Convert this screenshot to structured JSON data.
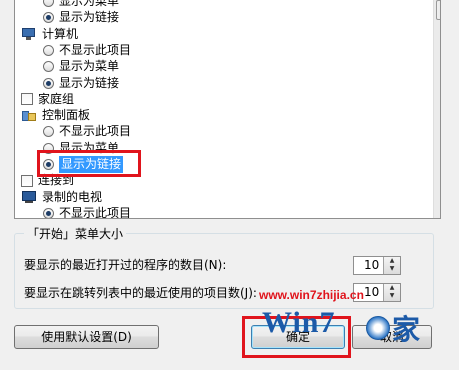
{
  "tree": [
    {
      "type": "radio",
      "checked": false,
      "indent": 1,
      "label": "显示为菜单",
      "icon": null
    },
    {
      "type": "radio",
      "checked": true,
      "indent": 1,
      "label": "显示为链接",
      "icon": null
    },
    {
      "type": "group",
      "checked": null,
      "indent": 0,
      "label": "计算机",
      "icon": "computer-icon"
    },
    {
      "type": "radio",
      "checked": false,
      "indent": 1,
      "label": "不显示此项目",
      "icon": null
    },
    {
      "type": "radio",
      "checked": false,
      "indent": 1,
      "label": "显示为菜单",
      "icon": null
    },
    {
      "type": "radio",
      "checked": true,
      "indent": 1,
      "label": "显示为链接",
      "icon": null
    },
    {
      "type": "checkbox",
      "checked": false,
      "indent": 0,
      "label": "家庭组",
      "icon": null
    },
    {
      "type": "group",
      "checked": null,
      "indent": 0,
      "label": "控制面板",
      "icon": "control-panel-icon"
    },
    {
      "type": "radio",
      "checked": false,
      "indent": 1,
      "label": "不显示此项目",
      "icon": null
    },
    {
      "type": "radio",
      "checked": false,
      "indent": 1,
      "label": "显示为菜单",
      "icon": null
    },
    {
      "type": "radio",
      "checked": true,
      "indent": 1,
      "label": "显示为链接",
      "icon": null,
      "highlighted": true
    },
    {
      "type": "checkbox",
      "checked": false,
      "indent": 0,
      "label": "连接到",
      "icon": null
    },
    {
      "type": "group",
      "checked": null,
      "indent": 0,
      "label": "录制的电视",
      "icon": "tv-icon"
    },
    {
      "type": "radio",
      "checked": true,
      "indent": 1,
      "label": "不显示此项目",
      "icon": null
    }
  ],
  "start_menu_size": {
    "group_title": "「开始」菜单大小",
    "recent_programs_label": "要显示的最近打开过的程序的数目(N):",
    "recent_programs_value": "10",
    "jump_list_label": "要显示在跳转列表中的最近使用的项目数(J):",
    "jump_list_value": "10"
  },
  "buttons": {
    "use_default": "使用默认设置(D)",
    "ok": "确定",
    "cancel": "取消"
  },
  "watermark": {
    "url": "www.win7zhijia.cn",
    "logo_text": "Win7",
    "logo_suffix": "家"
  },
  "colors": {
    "highlight": "#3399ff",
    "annotation_red": "#e0141c"
  }
}
